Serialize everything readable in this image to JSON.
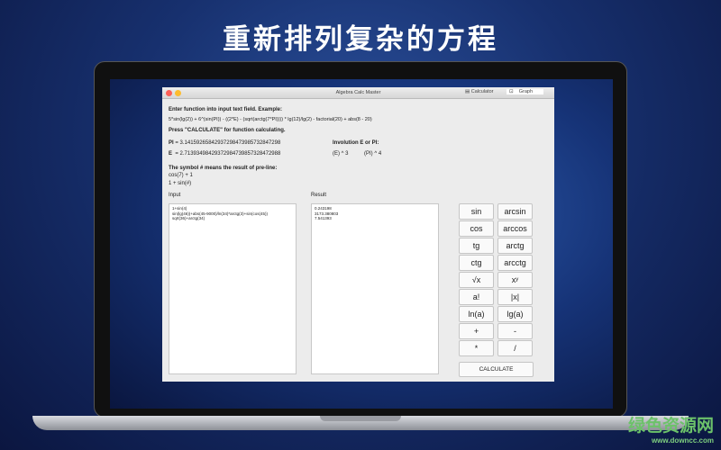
{
  "headline": "重新排列复杂的方程",
  "window": {
    "title": "Algebra Calc Master",
    "tabs": [
      {
        "label": "Calculator"
      },
      {
        "label": "Graph"
      }
    ]
  },
  "instructions": {
    "line1": "Enter function into input text field. Example:",
    "example": "5*sin(lg(2)) + 6^(sin(PI)) - ((2*E) - (sqrt(arctg(7*PI)))) * lg(12)/lg(2) - factorial(20) + abs(8 - 20)",
    "line2": "Press \"CALCULATE\" for function calculating.",
    "pi_label": "PI",
    "pi_value": "= 3.14159265842937298473985732847298",
    "e_label": "E",
    "e_value": "= 2.71393498429372984739857328472988",
    "involution_title": "Involution E or PI:",
    "inv1": "(E) ^ 3",
    "inv2": "(PI) ^ 4",
    "symbol_title": "The symbol # means the result of pre-line:",
    "sym1": "cos(7) + 1",
    "sym2": "1 + sin(#)"
  },
  "input": {
    "label": "Input",
    "lines": [
      "1+sin(4)",
      "sin(lg(46))+abs(45-9000)/ln(34)*arctg(3)+sin(cos(45))",
      "sqrt(36)+arctg(34)"
    ]
  },
  "result": {
    "label": "Result",
    "lines": [
      "0.243198",
      "3173.380803",
      "7.541393"
    ]
  },
  "keys": [
    "sin",
    "arcsin",
    "cos",
    "arccos",
    "tg",
    "arctg",
    "ctg",
    "arcctg",
    "√x",
    "xʸ",
    "a!",
    "|x|",
    "ln(a)",
    "lg(a)",
    "+",
    "-",
    "*",
    "/"
  ],
  "calculate_label": "CALCULATE",
  "watermark": {
    "name": "绿色资源网",
    "url": "www.downcc.com"
  }
}
